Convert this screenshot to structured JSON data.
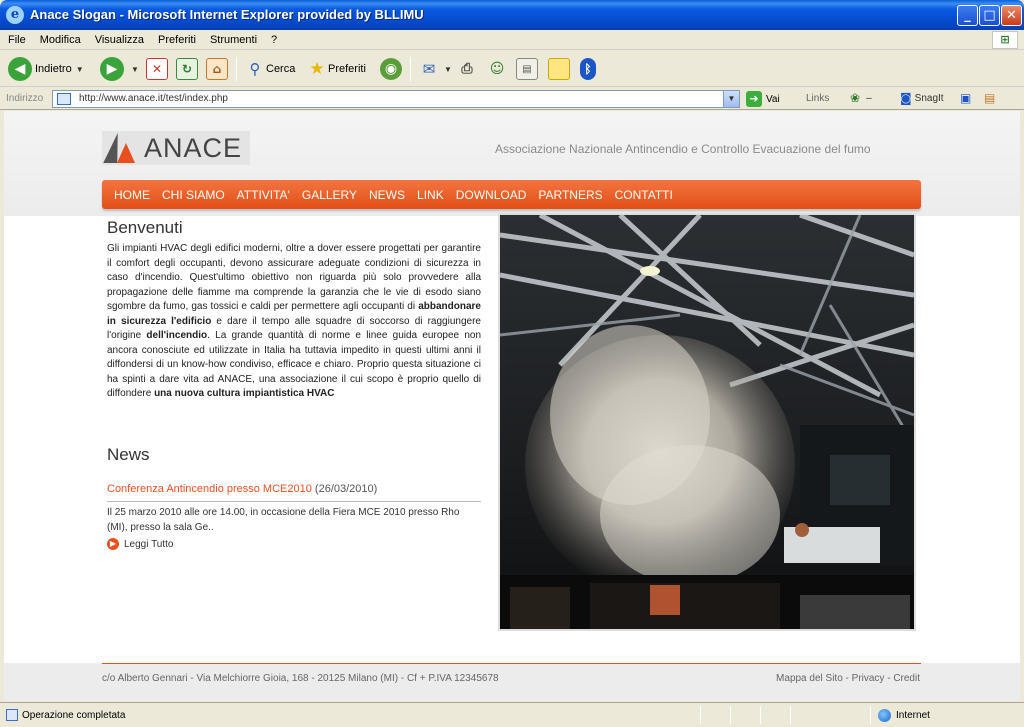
{
  "window": {
    "title": "Anace Slogan - Microsoft Internet Explorer provided by BLLIMU"
  },
  "menu": [
    "File",
    "Modifica",
    "Visualizza",
    "Preferiti",
    "Strumenti",
    "?"
  ],
  "toolbar": {
    "back_label": "Indietro",
    "search_label": "Cerca",
    "favorites_label": "Preferiti"
  },
  "addressbar": {
    "label": "Indirizzo",
    "url": "http://www.anace.it/test/index.php",
    "go_label": "Vai",
    "links_label": "Links",
    "snagit_label": "SnagIt"
  },
  "site": {
    "logo_text": "ANACE",
    "slogan": "Associazione Nazionale Antincendio e Controllo Evacuazione del fumo",
    "nav": [
      "HOME",
      "CHI SIAMO",
      "ATTIVITA'",
      "GALLERY",
      "NEWS",
      "LINK",
      "DOWNLOAD",
      "PARTNERS",
      "CONTATTI"
    ],
    "welcome_heading": "Benvenuti",
    "welcome_text_1": "Gli impianti HVAC degli edifici moderni, oltre a dover essere progettati per garantire il comfort degli occupanti, devono assicurare adeguate condizioni di sicurezza in caso d'incendio. Quest'ultimo obiettivo non riguarda più solo provvedere alla propagazione delle fiamme ma comprende la garanzia che le vie di esodo siano sgombre da fumo, gas tossici e caldi per permettere agli occupanti di ",
    "welcome_text_bold_1": "abbandonare in sicurezza l'edificio",
    "welcome_text_2": " e dare il tempo alle squadre di soccorso di raggiungere l'origine ",
    "welcome_text_bold_2": "dell'incendio",
    "welcome_text_3": ". La grande quantità di norme e linee guida europee non ancora conosciute ed utilizzate in Italia ha tuttavia impedito in questi ultimi anni il diffondersi di un know-how condiviso, efficace e chiaro. Proprio questa situazione ci ha spinti a dare vita ad ANACE, una associazione il cui scopo è proprio quello di diffondere ",
    "welcome_text_bold_3": "una nuova cultura impiantistica HVAC",
    "news_heading": "News",
    "news_title": "Conferenza Antincendio presso MCE2010",
    "news_date": "(26/03/2010)",
    "news_body": "Il 25 marzo 2010 alle ore 14.00, in occasione della Fiera MCE 2010 presso Rho (MI), presso la sala Ge..",
    "news_more": "Leggi Tutto",
    "footer_address": "c/o Alberto Gennari - Via Melchiorre Gioia, 168 - 20125 Milano (MI) - Cf + P.IVA 12345678",
    "footer_links": "Mappa del Sito - Privacy - Credit"
  },
  "statusbar": {
    "status": "Operazione completata",
    "zone": "Internet"
  }
}
